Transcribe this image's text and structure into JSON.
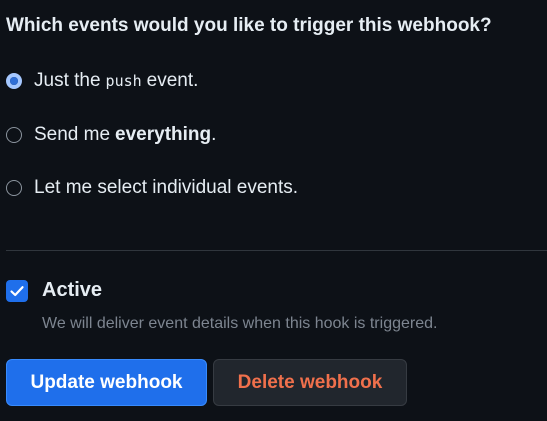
{
  "question": "Which events would you like to trigger this webhook?",
  "events": {
    "push_only": {
      "prefix": "Just the",
      "code": "push",
      "suffix": "event.",
      "selected": true
    },
    "everything": {
      "prefix": "Send me",
      "bold": "everything",
      "suffix": ".",
      "selected": false
    },
    "individual": {
      "label": "Let me select individual events.",
      "selected": false
    }
  },
  "active": {
    "label": "Active",
    "checked": true,
    "description": "We will deliver event details when this hook is triggered."
  },
  "buttons": {
    "update": "Update webhook",
    "delete": "Delete webhook"
  },
  "colors": {
    "background": "#0d1117",
    "accent": "#1f6feb",
    "danger_text": "#f0704c"
  }
}
